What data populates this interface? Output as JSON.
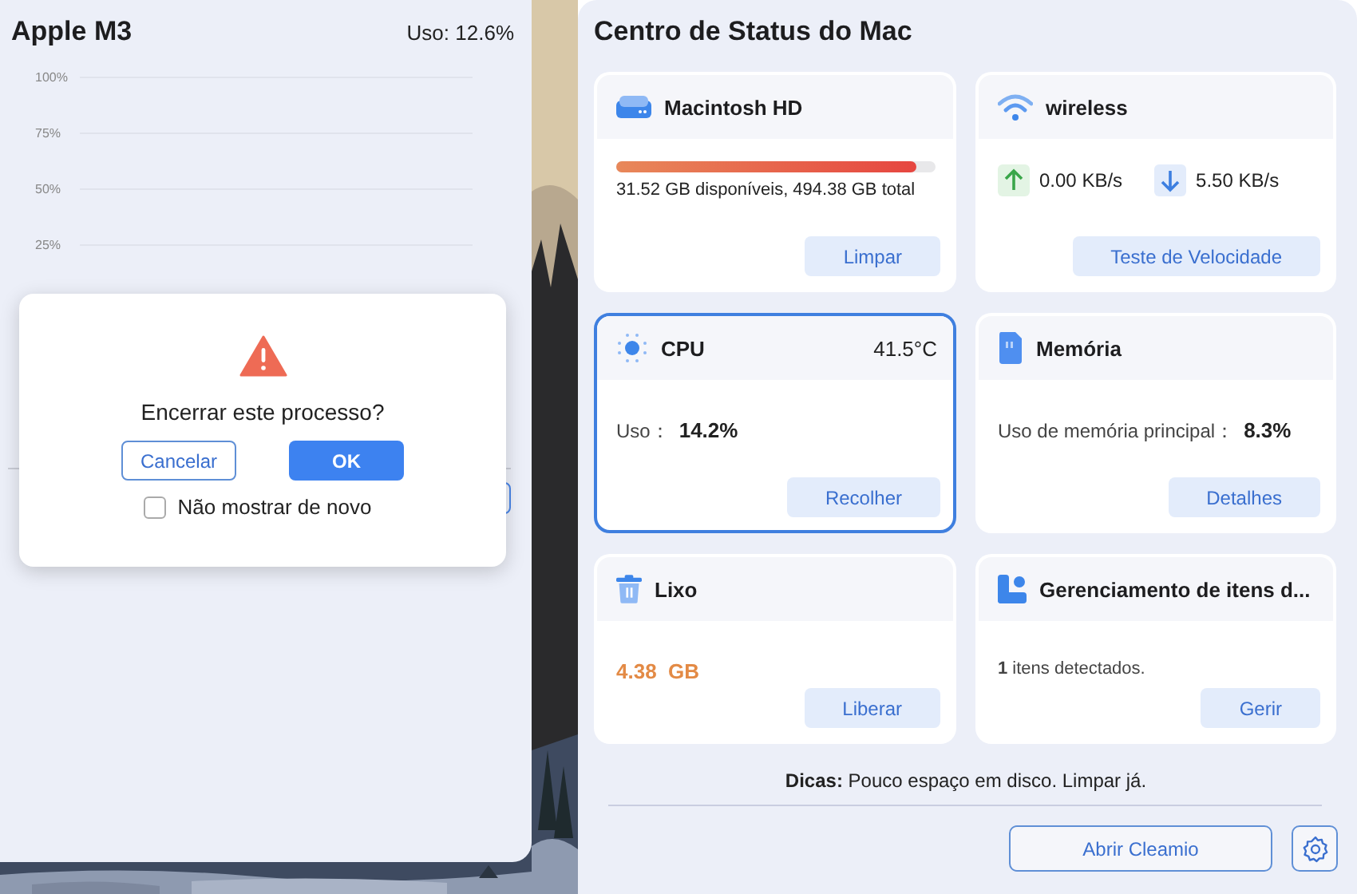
{
  "cpu_panel": {
    "title": "Apple M3",
    "usage": "Uso: 12.6%",
    "y_ticks": [
      "100%",
      "75%",
      "50%",
      "25%"
    ]
  },
  "dialog": {
    "message": "Encerrar este processo?",
    "buttons": [
      {
        "label": "Cancelar",
        "kind": "secondary"
      },
      {
        "label": "OK",
        "kind": "primary"
      }
    ],
    "checkbox": {
      "label": "Não mostrar de novo",
      "checked": false
    }
  },
  "status_center": {
    "title": "Centro de Status do Mac",
    "cards": [
      {
        "kind": "disk",
        "title": "Macintosh HD",
        "selected": false,
        "level": 0.94,
        "detail": "31.52 GB disponíveis, 494.38 GB total",
        "button": "Limpar"
      },
      {
        "kind": "network",
        "title": "wireless",
        "selected": false,
        "upload": "0.00 KB/s",
        "download": "5.50 KB/s",
        "button": "Teste de Velocidade"
      },
      {
        "kind": "cpu",
        "title": "CPU",
        "selected": true,
        "temperature": "41.5°C",
        "label": "Uso：",
        "value": "14.2%",
        "button": "Recolher"
      },
      {
        "kind": "memory",
        "title": "Memória",
        "selected": false,
        "label": "Uso de memória principal：",
        "value": "8.3%",
        "button": "Detalhes"
      },
      {
        "kind": "trash",
        "title": "Lixo",
        "selected": false,
        "value": "4.38  GB",
        "button": "Liberar"
      },
      {
        "kind": "items",
        "title": "Gerenciamento de itens d...",
        "selected": false,
        "detail": "**1** itens detectados.",
        "button": "Gerir"
      }
    ],
    "tip": "**Dicas:** Pouco espaço em disco. Limpar já.",
    "open_button": "Abrir Cleamio"
  }
}
